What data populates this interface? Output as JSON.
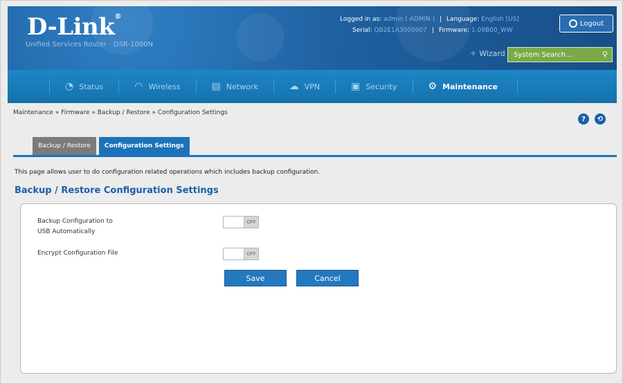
{
  "header": {
    "logo": "D-Link",
    "subtitle": "Unified Services Router - DSR-1000N",
    "logged_in_label": "Logged in as:",
    "logged_in_user": "admin ( ADMIN )",
    "language_label": "Language:",
    "language_value": "English [US]",
    "serial_label": "Serial:",
    "serial_value": "QB2E1A3000007",
    "firmware_label": "Firmware:",
    "firmware_value": "1.09B00_WW",
    "logout_label": "Logout",
    "wizard_label": "Wizard",
    "search_placeholder": "System Search..."
  },
  "nav": {
    "items": [
      {
        "label": "Status",
        "icon": "gauge-icon"
      },
      {
        "label": "Wireless",
        "icon": "wifi-icon"
      },
      {
        "label": "Network",
        "icon": "network-icon"
      },
      {
        "label": "VPN",
        "icon": "cloud-icon"
      },
      {
        "label": "Security",
        "icon": "lock-icon"
      },
      {
        "label": "Maintenance",
        "icon": "gears-icon"
      }
    ],
    "active": "Maintenance"
  },
  "breadcrumb": {
    "items": [
      "Maintenance",
      "Firmware",
      "Backup / Restore",
      "Configuration Settings"
    ],
    "separator": "»"
  },
  "tabs": [
    {
      "label": "Backup / Restore",
      "active": false
    },
    {
      "label": "Configuration Settings",
      "active": true
    }
  ],
  "description": "This page allows user to do configuration related operations which includes backup configuration.",
  "section_title": "Backup / Restore Configuration Settings",
  "form": {
    "backup_label_line1": "Backup Configuration to",
    "backup_label_line2": "USB Automatically",
    "backup_toggle": "OFF",
    "encrypt_label": "Encrypt Configuration File",
    "encrypt_toggle": "OFF",
    "save_label": "Save",
    "cancel_label": "Cancel"
  },
  "colors": {
    "header_blue": "#1e5f9f",
    "nav_blue": "#1d86c6",
    "accent_blue": "#1c73b9",
    "search_green": "#7aa948"
  }
}
